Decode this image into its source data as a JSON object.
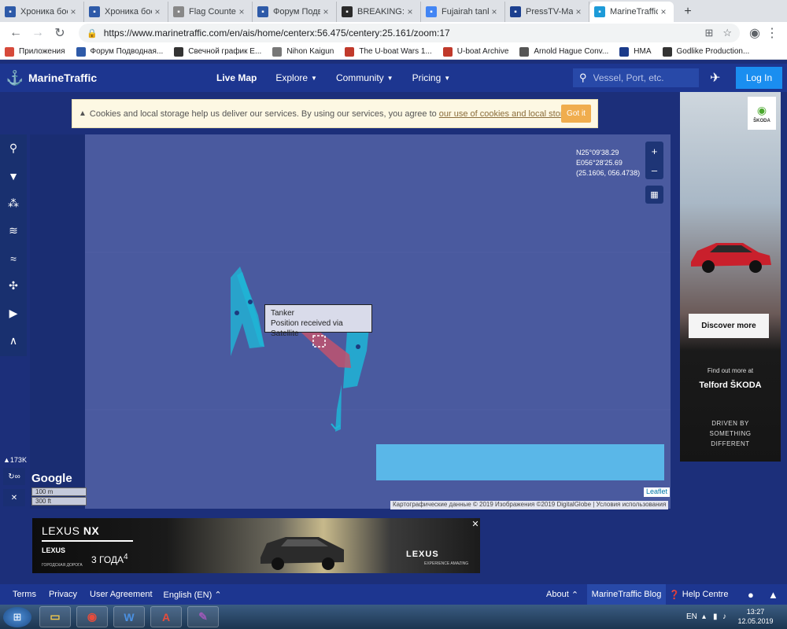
{
  "browser": {
    "tabs": [
      {
        "title": "Хроника бое",
        "icon": "forum-icon",
        "color": "#2e5aa8"
      },
      {
        "title": "Хроника бое",
        "icon": "forum-icon",
        "color": "#2e5aa8"
      },
      {
        "title": "Flag Counter",
        "icon": "flag-icon",
        "color": "#888888"
      },
      {
        "title": "Форум Подв",
        "icon": "forum-icon",
        "color": "#2e5aa8"
      },
      {
        "title": "BREAKING: IS",
        "icon": "alien-icon",
        "color": "#2a2a2a"
      },
      {
        "title": "Fujairah tank",
        "icon": "google-icon",
        "color": "#4285f4"
      },
      {
        "title": "PressTV-Mas",
        "icon": "presstv-icon",
        "color": "#1b3f8f"
      },
      {
        "title": "MarineTraffic",
        "icon": "marinetraffic-icon",
        "color": "#1d9bd8"
      }
    ],
    "url": "https://www.marinetraffic.com/en/ais/home/centerx:56.475/centery:25.161/zoom:17",
    "bookmarks": [
      {
        "label": "Приложения",
        "icon": "apps-icon",
        "color": "#d64a3b"
      },
      {
        "label": "Форум Подводная...",
        "icon": "forum-icon",
        "color": "#2e5aa8"
      },
      {
        "label": "Свечной график E...",
        "icon": "investing-icon",
        "color": "#333333"
      },
      {
        "label": "Nihon Kaigun",
        "icon": "globe-icon",
        "color": "#777777"
      },
      {
        "label": "The U-boat Wars 1...",
        "icon": "uboat-icon",
        "color": "#c0392b"
      },
      {
        "label": "U-boat Archive",
        "icon": "archive-icon",
        "color": "#c0392b"
      },
      {
        "label": "Arnold Hague Conv...",
        "icon": "anchor-icon",
        "color": "#555555"
      },
      {
        "label": "HMA",
        "icon": "hma-icon",
        "color": "#1a3a8a"
      },
      {
        "label": "Godlike Production...",
        "icon": "eye-icon",
        "color": "#333333"
      }
    ]
  },
  "header": {
    "brand": "MarineTraffic",
    "nav": [
      "Live Map",
      "Explore",
      "Community",
      "Pricing"
    ],
    "search_placeholder": "Vessel, Port, etc.",
    "login": "Log In"
  },
  "cookie": {
    "text": "Cookies and local storage help us deliver our services. By using our services, you agree to",
    "link": "our use of cookies and local storage",
    "period": ".",
    "button": "Got it"
  },
  "map": {
    "coord_line1": "N25°09'38.29",
    "coord_line2": "E056°28'25.69",
    "coord_line3": "(25.1606, 056.4738)",
    "zoom_in": "+",
    "zoom_out": "–",
    "tooltip_line1": "Tanker",
    "tooltip_line2": "Position received via Satellite",
    "vessel_count": "173K",
    "google": "Google",
    "scale_m": "100 m",
    "scale_ft": "300 ft",
    "leaflet": "Leaflet",
    "attribution": "Картографические данные © 2019 Изображения ©2019 DigitalGlobe | Условия использования",
    "colors": {
      "tanker": "#c0546e",
      "other_vessel": "#1fb5d6",
      "sea": "#4a5a9f"
    }
  },
  "ad_right": {
    "brand": "ŠKODA",
    "button": "Discover more",
    "line1": "Find out more at",
    "line2": "Telford ŠKODA",
    "line3a": "DRIVEN BY",
    "line3b": "SOMETHING",
    "line3c": "DIFFERENT"
  },
  "ad_bottom": {
    "model_a": "LEXUS ",
    "model_b": "NX",
    "small_brand": "LEXUS",
    "small_sub": "ГОРОДСКАЯ ДОРОГА",
    "offer": "3 ГОДА",
    "offer_sup": "4",
    "brand": "LEXUS",
    "tagline": "EXPERIENCE AMAZING"
  },
  "footer": {
    "links": [
      "Terms",
      "Privacy",
      "User Agreement"
    ],
    "language": "English (EN)",
    "about": "About",
    "blog": "MarineTraffic Blog",
    "help": "Help Centre"
  },
  "taskbar": {
    "lang": "EN",
    "time": "13:27",
    "date": "12.05.2019"
  }
}
